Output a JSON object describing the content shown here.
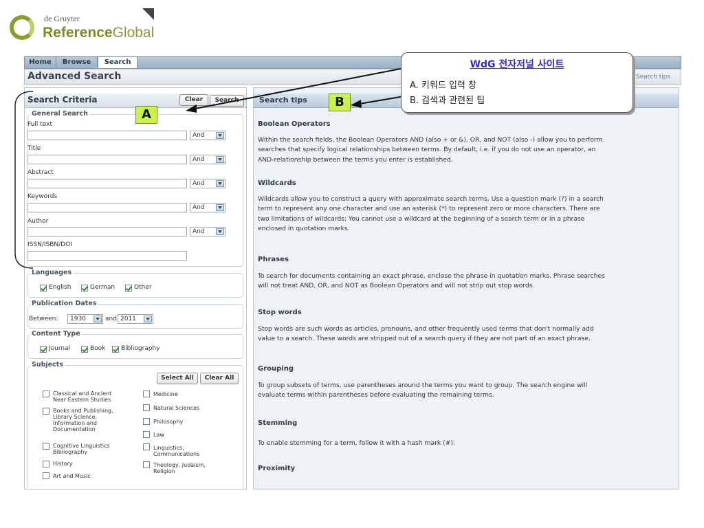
{
  "logo": {
    "small": "de Gruyter",
    "bold": "Reference",
    "light": "Global"
  },
  "nav": {
    "tabs": [
      "Home",
      "Browse",
      "Search"
    ]
  },
  "header": {
    "title": "Advanced Search",
    "tips_link": "Search tips"
  },
  "left": {
    "title": "Search Criteria",
    "clear_btn": "Clear",
    "search_btn": "Search",
    "general_legend": "General Search",
    "fields": [
      {
        "label": "Full text",
        "op": "And"
      },
      {
        "label": "Title",
        "op": "And"
      },
      {
        "label": "Abstract",
        "op": "And"
      },
      {
        "label": "Keywords",
        "op": "And"
      },
      {
        "label": "Author",
        "op": "And"
      }
    ],
    "isbn_label": "ISSN/ISBN/DOI",
    "languages_legend": "Languages",
    "languages": [
      "English",
      "German",
      "Other"
    ],
    "pubdates_legend": "Publication Dates",
    "between_label": "Between:",
    "from_year": "1930",
    "and_label": "and",
    "to_year": "2011",
    "content_legend": "Content Type",
    "content_types": [
      "Journal",
      "Book",
      "Bibliography"
    ],
    "subjects_legend": "Subjects",
    "select_all": "Select All",
    "clear_all": "Clear All",
    "subjects_col1": [
      [
        "Classical and Ancient",
        "Near Eastern Studies"
      ],
      [
        "Books and Publishing,",
        "Library Science,",
        "Information and",
        "Documentation"
      ],
      [
        "Cognitive Linguistics",
        "Bibliography"
      ],
      [
        "History"
      ],
      [
        "Art and Music"
      ]
    ],
    "subjects_col2": [
      [
        "Medicine"
      ],
      [
        "Natural Sciences"
      ],
      [
        "Philosophy"
      ],
      [
        "Law"
      ],
      [
        "Linguistics,",
        "Communications"
      ],
      [
        "Theology, Judaism,",
        "Religion"
      ]
    ]
  },
  "right": {
    "title": "Search tips",
    "sections": [
      {
        "heading": "Boolean Operators",
        "lines": [
          "Within the search fields, the Boolean Operators AND (also + or &), OR, and NOT (also -) allow you to perform",
          "searches that specify logical relationships between terms. By default, i.e. if you do not use an operator, an",
          "AND-relationship between the terms you enter is established."
        ]
      },
      {
        "heading": "Wildcards",
        "lines": [
          "Wildcards allow you to construct a query with approximate search terms. Use a question mark (?) in a search",
          "term to represent any one character and use an asterisk (*) to represent zero or more characters. There are",
          "two limitations of wildcards: You cannot use a wildcard at the beginning of a search term or in a phrase",
          "enclosed in quotation marks."
        ]
      },
      {
        "heading": "Phrases",
        "lines": [
          "To search for documents containing an exact phrase, enclose the phrase in quotation marks. Phrase searches",
          "will not treat AND, OR, and NOT as Boolean Operators and will not strip out stop words."
        ]
      },
      {
        "heading": "Stop words",
        "lines": [
          "Stop words are such words as articles, pronouns, and other frequently used terms that don't normally add",
          "value to a search. These words are stripped out of a search query if they are not part of an exact phrase."
        ]
      },
      {
        "heading": "Grouping",
        "lines": [
          "To group subsets of terms, use parentheses around the terms you want to group. The search engine will",
          "evaluate terms within parentheses before evaluating the remaining terms."
        ]
      },
      {
        "heading": "Stemming",
        "lines": [
          "To enable stemming for a term, follow it with a hash mark (#)."
        ]
      },
      {
        "heading": "Proximity",
        "lines": []
      }
    ]
  },
  "callout": {
    "title": "WdG 전자저널 사이트",
    "line_a": "A. 키워드 입력 창",
    "line_b": "B. 검색과 관련된 팁"
  },
  "badges": {
    "a": "A",
    "b": "B"
  },
  "colors": {
    "tab_bar": "#9cb1c4",
    "badge": "#c9f24a",
    "callout_title": "#2b2bd0",
    "logo_green": "#7a8f22"
  }
}
